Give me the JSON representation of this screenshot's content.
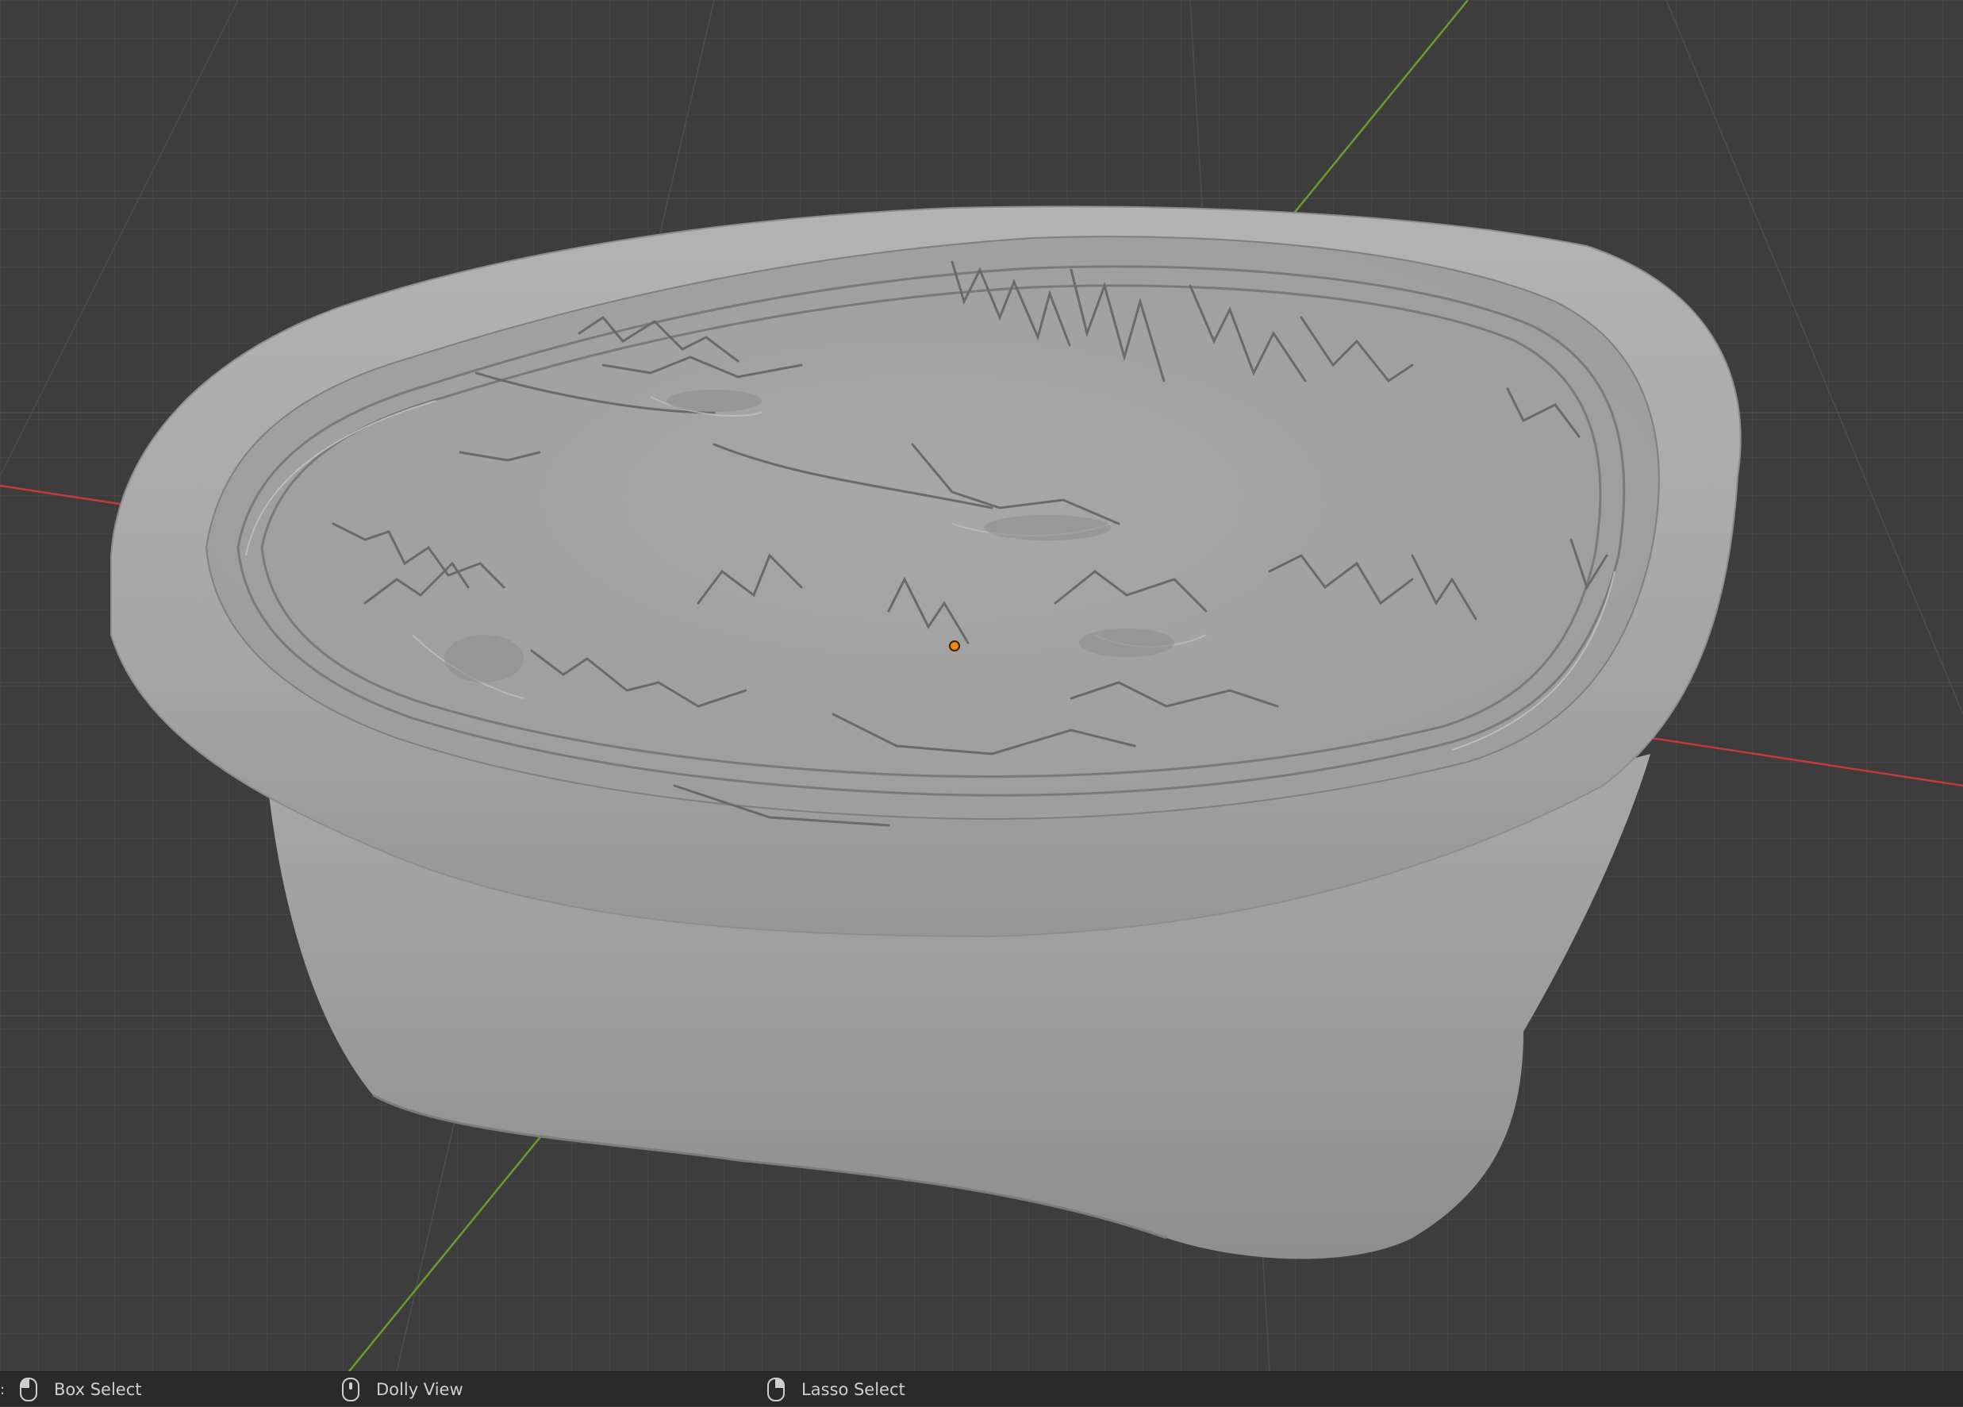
{
  "viewport": {
    "object": "relief-tray-mesh",
    "axis_colors": {
      "x": "#c23a3a",
      "y": "#6e9a2f"
    },
    "origin_color": "#f08a1d",
    "background": "#3d3d3d"
  },
  "statusbar": {
    "items": [
      {
        "icon": "mouse-left-icon",
        "label": "Box Select"
      },
      {
        "icon": "mouse-middle-icon",
        "label": "Dolly View"
      },
      {
        "icon": "mouse-right-icon",
        "label": "Lasso Select"
      }
    ]
  }
}
